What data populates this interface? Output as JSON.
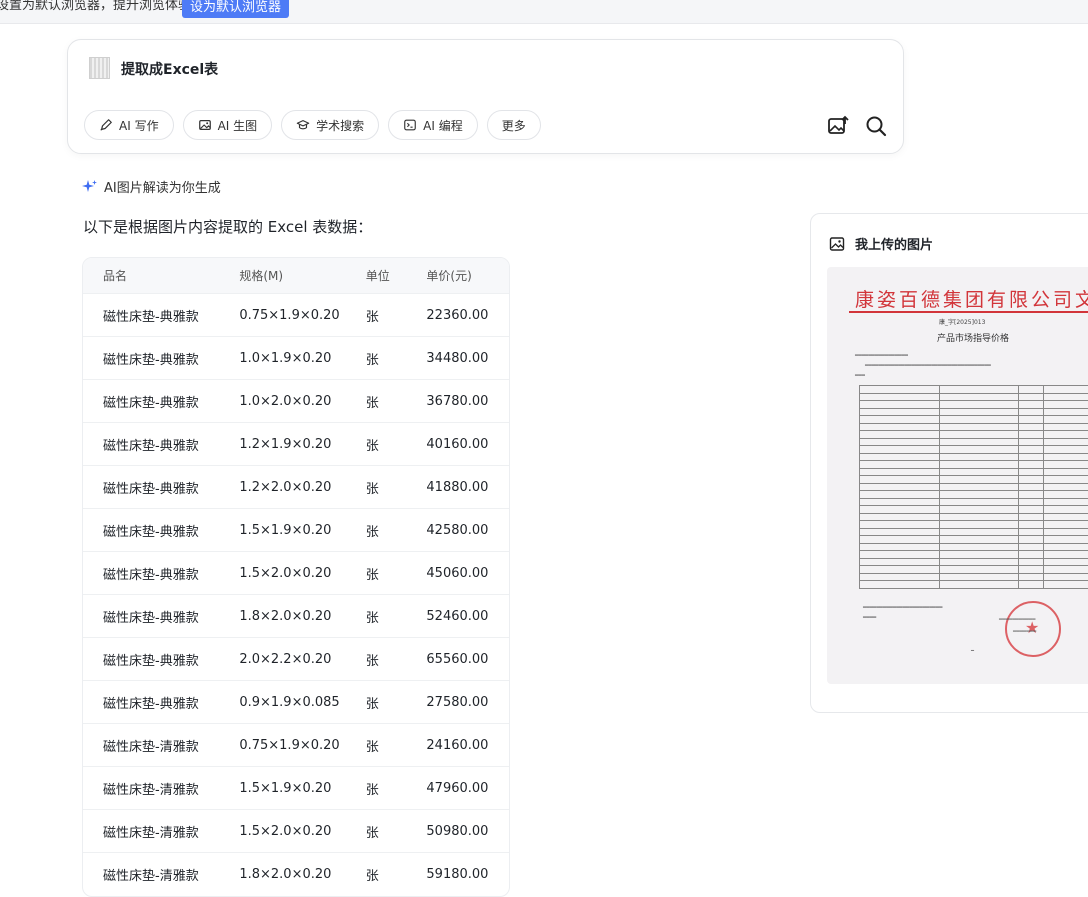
{
  "notice": {
    "text": "设置为默认浏览器，提升浏览体验",
    "button": "设为默认浏览器"
  },
  "search": {
    "query": "提取成Excel表",
    "chips": [
      {
        "label": "AI 写作",
        "icon": "pen-icon"
      },
      {
        "label": "AI 生图",
        "icon": "image-icon"
      },
      {
        "label": "学术搜索",
        "icon": "graduation-cap-icon"
      },
      {
        "label": "AI 编程",
        "icon": "code-icon"
      },
      {
        "label": "更多",
        "icon": ""
      }
    ]
  },
  "ai_label": "AI图片解读为你生成",
  "intro": "以下是根据图片内容提取的 Excel 表数据：",
  "table": {
    "headers": [
      "品名",
      "规格(M)",
      "单位",
      "单价(元)"
    ],
    "rows": [
      [
        "磁性床垫-典雅款",
        "0.75×1.9×0.20",
        "张",
        "22360.00"
      ],
      [
        "磁性床垫-典雅款",
        "1.0×1.9×0.20",
        "张",
        "34480.00"
      ],
      [
        "磁性床垫-典雅款",
        "1.0×2.0×0.20",
        "张",
        "36780.00"
      ],
      [
        "磁性床垫-典雅款",
        "1.2×1.9×0.20",
        "张",
        "40160.00"
      ],
      [
        "磁性床垫-典雅款",
        "1.2×2.0×0.20",
        "张",
        "41880.00"
      ],
      [
        "磁性床垫-典雅款",
        "1.5×1.9×0.20",
        "张",
        "42580.00"
      ],
      [
        "磁性床垫-典雅款",
        "1.5×2.0×0.20",
        "张",
        "45060.00"
      ],
      [
        "磁性床垫-典雅款",
        "1.8×2.0×0.20",
        "张",
        "52460.00"
      ],
      [
        "磁性床垫-典雅款",
        "2.0×2.2×0.20",
        "张",
        "65560.00"
      ],
      [
        "磁性床垫-典雅款",
        "0.9×1.9×0.085",
        "张",
        "27580.00"
      ],
      [
        "磁性床垫-清雅款",
        "0.75×1.9×0.20",
        "张",
        "24160.00"
      ],
      [
        "磁性床垫-清雅款",
        "1.5×1.9×0.20",
        "张",
        "47960.00"
      ],
      [
        "磁性床垫-清雅款",
        "1.5×2.0×0.20",
        "张",
        "50980.00"
      ],
      [
        "磁性床垫-清雅款",
        "1.8×2.0×0.20",
        "张",
        "59180.00"
      ]
    ]
  },
  "upload": {
    "title": "我上传的图片",
    "doc_title": "康姿百德集团有限公司文件",
    "doc_number": "康_字[2025]013",
    "doc_subtitle": "产品市场指导价格"
  }
}
